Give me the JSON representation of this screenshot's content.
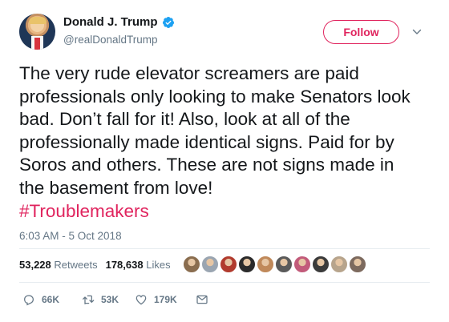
{
  "author": {
    "display_name": "Donald J. Trump",
    "handle": "@realDonaldTrump"
  },
  "follow_label": "Follow",
  "tweet": {
    "text": "The very rude elevator screamers are paid professionals only looking to make Senators look bad. Don’t fall for it! Also, look at all of the professionally made identical signs. Paid for by Soros and others. These are not signs made in the basement from love!",
    "hashtag": "#Troublemakers",
    "timestamp": "6:03 AM - 5 Oct 2018"
  },
  "stats": {
    "retweets_count": "53,228",
    "retweets_label": "Retweets",
    "likes_count": "178,638",
    "likes_label": "Likes"
  },
  "actions": {
    "reply_count": "66K",
    "retweet_count": "53K",
    "like_count": "179K"
  },
  "colors": {
    "accent": "#e0245e",
    "verified": "#1da1f2",
    "secondary_text": "#657786"
  },
  "likers": [
    "#8a6d4f",
    "#9aa5b1",
    "#b13b2e",
    "#2b2b2b",
    "#c0895a",
    "#5a5a5a",
    "#c25b7a",
    "#3a3a3a",
    "#b7a48c",
    "#7d6a5e"
  ]
}
